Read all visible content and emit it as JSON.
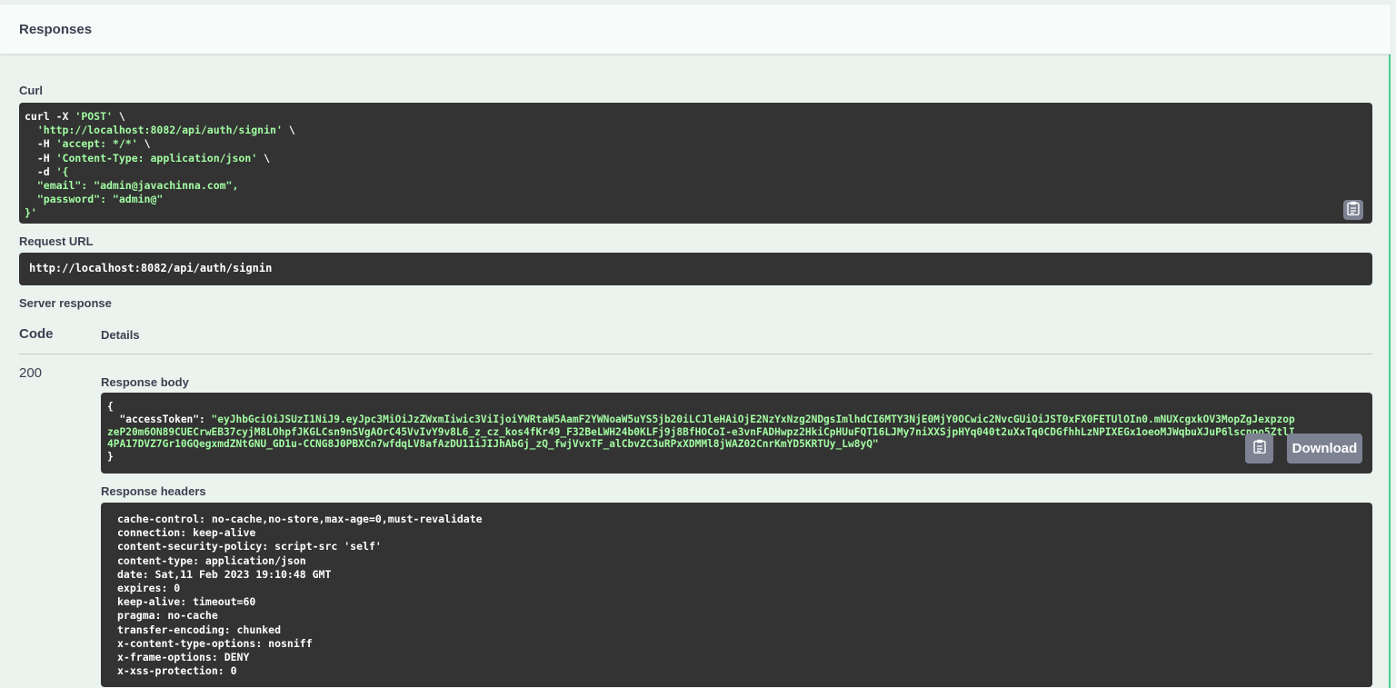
{
  "section_title": "Responses",
  "curl": {
    "label": "Curl",
    "lines": [
      {
        "plain": "curl -X ",
        "str": "'POST'",
        "tail": " \\"
      },
      {
        "plain": "  ",
        "str": "'http://localhost:8082/api/auth/signin'",
        "tail": " \\"
      },
      {
        "plain": "  -H ",
        "str": "'accept: */*'",
        "tail": " \\"
      },
      {
        "plain": "  -H ",
        "str": "'Content-Type: application/json'",
        "tail": " \\"
      },
      {
        "plain": "  -d ",
        "str": "'{",
        "tail": ""
      },
      {
        "plain": "",
        "str": "  \"email\": \"admin@javachinna.com\",",
        "tail": ""
      },
      {
        "plain": "",
        "str": "  \"password\": \"admin@\"",
        "tail": ""
      },
      {
        "plain": "",
        "str": "}'",
        "tail": ""
      }
    ],
    "copy_icon": "clipboard-icon"
  },
  "request_url": {
    "label": "Request URL",
    "value": "http://localhost:8082/api/auth/signin"
  },
  "server_response": {
    "label": "Server response",
    "col_code": "Code",
    "col_details": "Details",
    "code": "200",
    "response_body_label": "Response body",
    "body_open": "{",
    "body_key": "  \"accessToken\": ",
    "body_lines": [
      "\"eyJhbGciOiJSUzI1NiJ9.eyJpc3MiOiJzZWxmIiwic3ViIjoiYWRtaW5AamF2YWNoaW5uYS5jb20iLCJleHAiOjE2NzYxNzg2NDgsImlhdCI6MTY3NjE0MjY0OCwic2NvcGUiOiJST0xFX0FETUlOIn0.mNUXcgxkOV3MopZgJexpzop",
      "zeP20m6ON89CUECrwEB37cyjM8LOhpfJKGLCsn9nSVgAOrC45VvIvY9v8L6_z_cz_kos4fKr49_F32BeLWH24b0KLFj9j8BfHOCoI-e3vnFADHwpz2HkiCpHUuFQT16LJMy7niXXSjpHYq040t2uXxTq0CDGfhhLzNPIXEGx1oeoMJWqbuXJuP6lscnpo5ZtlI",
      "4PA17DVZ7Gr10GQegxmdZNtGNU_GD1u-CCNG8J0PBXCn7wfdqLV8afAzDU11iJIJhAbGj_zQ_fwjVvxTF_alCbvZC3uRPxXDMMl8jWAZ02CnrKmYD5KRTUy_Lw8yQ\""
    ],
    "body_close": "}",
    "download_label": "Download",
    "response_headers_label": "Response headers",
    "headers": [
      "cache-control: no-cache,no-store,max-age=0,must-revalidate",
      "connection: keep-alive",
      "content-security-policy: script-src 'self'",
      "content-type: application/json",
      "date: Sat,11 Feb 2023 19:10:48 GMT",
      "expires: 0",
      "keep-alive: timeout=60",
      "pragma: no-cache",
      "transfer-encoding: chunked",
      "x-content-type-options: nosniff",
      "x-frame-options: DENY",
      "x-xss-protection: 0"
    ]
  },
  "colors": {
    "background": "#ebf3ee",
    "code_bg": "#333333",
    "string_green": "#a2fca2",
    "button_gray": "#7d8293",
    "accent_green": "#49cc90"
  }
}
